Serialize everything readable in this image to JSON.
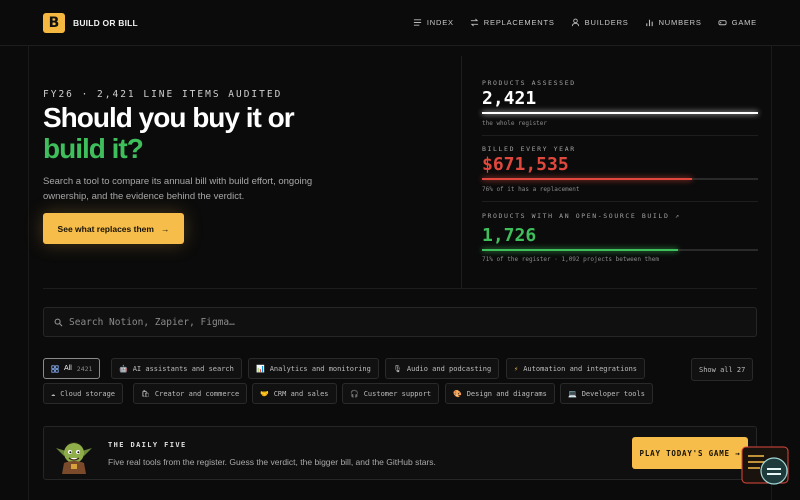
{
  "brand": {
    "logo_letter": "B",
    "name": "BUILD OR BILL"
  },
  "nav": [
    {
      "label": "INDEX",
      "icon": "list-icon"
    },
    {
      "label": "REPLACEMENTS",
      "icon": "swap-icon"
    },
    {
      "label": "BUILDERS",
      "icon": "user-icon"
    },
    {
      "label": "NUMBERS",
      "icon": "bar-chart-icon"
    },
    {
      "label": "GAME",
      "icon": "gamepad-icon"
    }
  ],
  "hero": {
    "eyebrow": "FY26 · 2,421 LINE ITEMS AUDITED",
    "title_line1": "Should you buy it or",
    "title_line2": "build it?",
    "description": "Search a tool to compare its annual bill with build effort, ongoing ownership, and the evidence behind the verdict.",
    "cta_label": "See what replaces them",
    "cta_arrow": "→"
  },
  "stats": [
    {
      "label": "PRODUCTS ASSESSED",
      "value": "2,421",
      "note": "the whole register",
      "fill_percent": 100,
      "color": "#ffffff"
    },
    {
      "label": "BILLED EVERY YEAR",
      "value": "$671,535",
      "note": "76% of it has a replacement",
      "fill_percent": 76,
      "color": "#e0483e"
    },
    {
      "label": "PRODUCTS WITH AN OPEN-SOURCE BUILD ↗",
      "value": "1,726",
      "note": "71% of the register · 1,092 projects between them",
      "fill_percent": 71,
      "color": "#3fbf5c"
    }
  ],
  "search": {
    "placeholder": "Search Notion, Zapier, Figma…",
    "value": ""
  },
  "categories": {
    "all": {
      "label": "All",
      "count": "2421"
    },
    "items": [
      {
        "label": "AI assistants and search",
        "icon": "robot-icon"
      },
      {
        "label": "Analytics and monitoring",
        "icon": "chart-icon"
      },
      {
        "label": "Audio and podcasting",
        "icon": "microphone-icon"
      },
      {
        "label": "Automation and integrations",
        "icon": "bolt-icon"
      },
      {
        "label": "Cloud storage",
        "icon": "cloud-icon"
      },
      {
        "label": "Creator and commerce",
        "icon": "shopping-bags-icon"
      },
      {
        "label": "CRM and sales",
        "icon": "handshake-icon"
      },
      {
        "label": "Customer support",
        "icon": "headset-icon"
      },
      {
        "label": "Design and diagrams",
        "icon": "palette-icon"
      },
      {
        "label": "Developer tools",
        "icon": "laptop-icon"
      }
    ],
    "show_all": "Show all 27"
  },
  "daily": {
    "label": "THE DAILY FIVE",
    "description": "Five real tools from the register. Guess the verdict, the bigger bill, and the GitHub stars.",
    "play_label": "PLAY TODAY'S GAME →"
  },
  "colors": {
    "accent": "#f6bd4a",
    "green": "#3fbf5c",
    "red": "#e0483e",
    "background": "#0b0b0b"
  }
}
